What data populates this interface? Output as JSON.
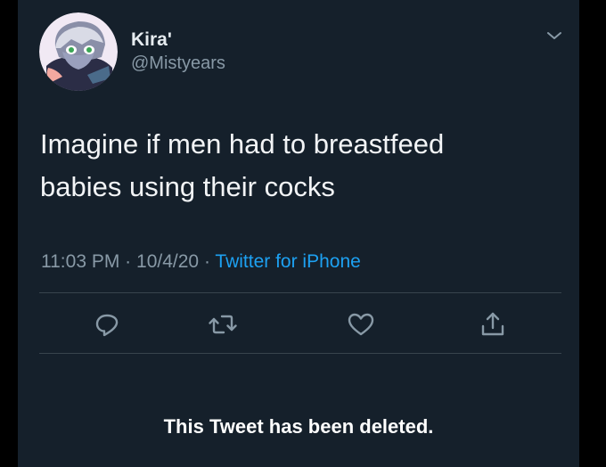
{
  "tweet": {
    "display_name": "Kira'",
    "handle": "@Mistyears",
    "text_line1": "Imagine if men had to breastfeed",
    "text_line2": "babies using their cocks",
    "time": "11:03 PM",
    "date": "10/4/20",
    "separator": "·",
    "source": "Twitter for iPhone"
  },
  "actions": {
    "reply_icon": "reply-icon",
    "retweet_icon": "retweet-icon",
    "like_icon": "heart-icon",
    "share_icon": "share-icon"
  },
  "notice": {
    "deleted_text": "This Tweet has been deleted."
  },
  "colors": {
    "background": "#15202b",
    "primary_text": "#e6ecf0",
    "secondary_text": "#8899a6",
    "link": "#1da1f2",
    "divider": "#38444d"
  }
}
